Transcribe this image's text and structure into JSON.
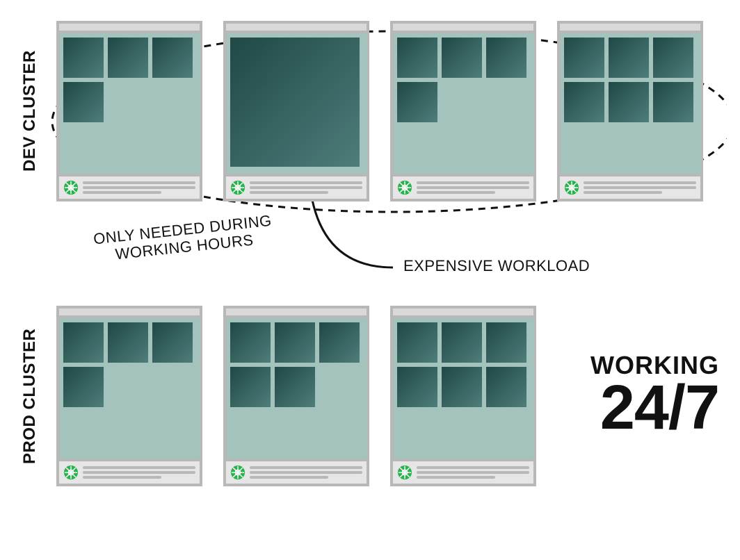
{
  "dev": {
    "vlabel": "DEV CLUSTER",
    "annotation_hours_line1": "ONLY NEEDED DURING",
    "annotation_hours_line2": "WORKING HOURS",
    "annotation_expensive": "EXPENSIVE WORKLOAD",
    "cards": [
      {
        "pods": 4,
        "big": false
      },
      {
        "pods": 1,
        "big": true
      },
      {
        "pods": 4,
        "big": false
      },
      {
        "pods": 6,
        "big": false
      }
    ]
  },
  "prod": {
    "vlabel": "PROD CLUSTER",
    "working_line1": "WORKING",
    "working_line2": "24/7",
    "cards": [
      {
        "pods": 4,
        "big": false
      },
      {
        "pods": 5,
        "big": false
      },
      {
        "pods": 6,
        "big": false
      }
    ]
  },
  "colors": {
    "card_border": "#b8b8b8",
    "card_bg": "#e6e6e6",
    "body_bg": "#a4c3bd",
    "pod_dark": "#1f4846",
    "pod_light": "#4e7d7a",
    "helm": "#2db04f"
  }
}
